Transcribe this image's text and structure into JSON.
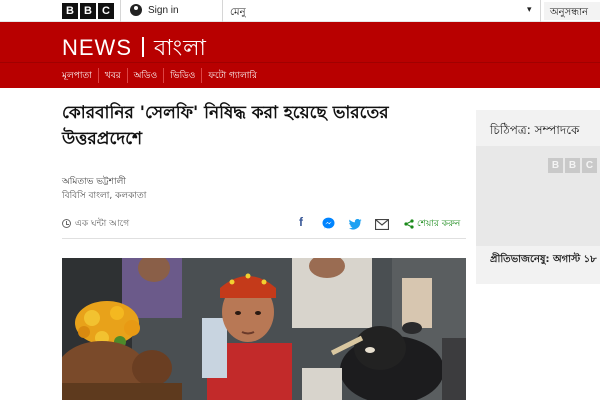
{
  "topbar": {
    "logo_letters": [
      "B",
      "B",
      "C"
    ],
    "signin_label": "Sign in",
    "menu_label": "মেনু",
    "search_label": "অনুসন্ধান"
  },
  "header": {
    "news_label": "NEWS",
    "language_label": "বাংলা"
  },
  "nav": {
    "items": [
      "মূলপাতা",
      "খবর",
      "অডিও",
      "ভিডিও",
      "ফটো গ্যালারি"
    ]
  },
  "article": {
    "headline": "কোরবানির 'সেলফি' নিষিদ্ধ করা হয়েছে ভারতের উত্তরপ্রদেশে",
    "author": "অমিতাভ ভট্টশালী",
    "author_org": "বিবিসি বাংলা, কলকাতা",
    "time": "এক ঘন্টা আগে",
    "share_label": "শেয়ার করুন"
  },
  "sidebar": {
    "title": "চিঠিপত্র: সম্পাদকে",
    "logo_letters": [
      "B",
      "B",
      "C"
    ],
    "caption": "প্রীতিভাজনেষু: অগাস্ট ১৮"
  },
  "colors": {
    "brand_red": "#b80000",
    "share_green": "#1a8a1a",
    "facebook_blue": "#3b5998",
    "messenger_blue": "#0084ff",
    "twitter_blue": "#1da1f2"
  }
}
